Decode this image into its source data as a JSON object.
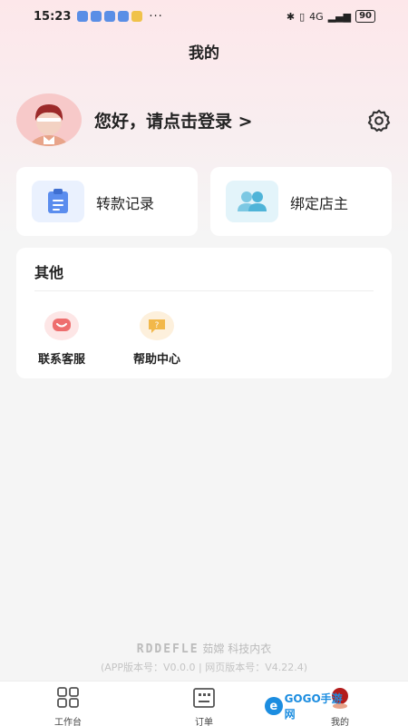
{
  "status_bar": {
    "time": "15:23",
    "dots": "···",
    "network": "4G",
    "battery": "90"
  },
  "page": {
    "title": "我的"
  },
  "profile": {
    "login_prompt": "您好，请点击登录 >"
  },
  "quick_cards": [
    {
      "label": "转款记录",
      "icon": "clipboard-icon",
      "color": "#5b8dee"
    },
    {
      "label": "绑定店主",
      "icon": "users-icon",
      "color": "#4fb4d8"
    }
  ],
  "other": {
    "title": "其他",
    "items": [
      {
        "label": "联系客服",
        "icon": "chat-smile-icon",
        "color": "#ee6e6e"
      },
      {
        "label": "帮助中心",
        "icon": "help-chat-icon",
        "color": "#f2b84b"
      }
    ]
  },
  "footer": {
    "brand_logo": "RDDEFLE",
    "brand_name": "茹嫦",
    "brand_tagline": "科技内衣",
    "version": "(APP版本号：V0.0.0 | 网页版本号：V4.22.4)"
  },
  "tabbar": {
    "tabs": [
      {
        "label": "工作台",
        "icon": "grid-icon"
      },
      {
        "label": "订单",
        "icon": "order-icon"
      },
      {
        "label": "我的",
        "icon": "profile-icon",
        "active": true
      }
    ]
  },
  "watermark": {
    "text": "GOGO手游网"
  }
}
